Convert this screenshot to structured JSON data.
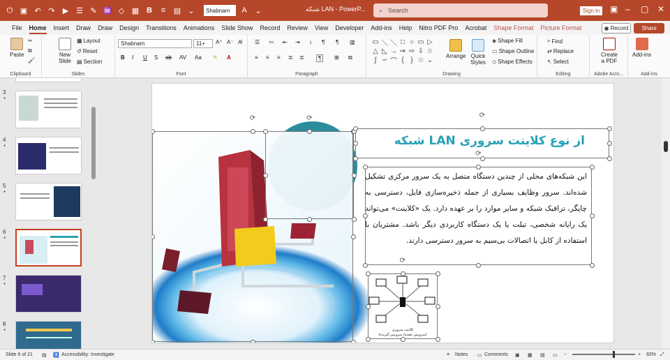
{
  "titlebar": {
    "font_name": "Shabnam",
    "doc_title": "شبکه LAN  -  PowerP...",
    "search_placeholder": "Search",
    "sign_in": "Sign in",
    "accent": "#b7472a"
  },
  "tabs": [
    "File",
    "Home",
    "Insert",
    "Draw",
    "Draw",
    "Design",
    "Transitions",
    "Animations",
    "Slide Show",
    "Record",
    "Review",
    "View",
    "Developer",
    "Add-ins",
    "Help",
    "Nitro PDF Pro",
    "Acrobat"
  ],
  "context_tabs": [
    "Shape Format",
    "Picture Format"
  ],
  "record_label": "Record",
  "share_label": "Share",
  "ribbon": {
    "clipboard": {
      "paste": "Paste",
      "label": "Clipboard"
    },
    "slides": {
      "new_slide": "New Slide",
      "layout": "Layout",
      "reset": "Reset",
      "section": "Section",
      "label": "Slides"
    },
    "font": {
      "name": "Shabnam",
      "size": "11+",
      "label": "Font",
      "bold": "B",
      "italic": "I",
      "underline": "U",
      "strike": "S",
      "shadow": "ab",
      "spacing": "AV",
      "case": "Aa"
    },
    "paragraph": {
      "label": "Paragraph"
    },
    "drawing": {
      "arrange": "Arrange",
      "quick_styles": "Quick Styles",
      "fill": "Shape Fill",
      "outline": "Shape Outline",
      "effects": "Shape Effects",
      "label": "Drawing"
    },
    "editing": {
      "find": "Find",
      "replace": "Replace",
      "select": "Select",
      "label": "Editing"
    },
    "acrobat": {
      "create": "Create a PDF",
      "label": "Adobe Acro..."
    },
    "addins": {
      "button": "Add-ins",
      "label": "Add-ins"
    }
  },
  "thumbnails": [
    {
      "num": "3",
      "star": "*"
    },
    {
      "num": "4",
      "star": "*"
    },
    {
      "num": "5",
      "star": "*"
    },
    {
      "num": "6",
      "star": "*"
    },
    {
      "num": "7",
      "star": "*"
    },
    {
      "num": "8",
      "star": "*"
    }
  ],
  "slide": {
    "title": "شبکه LAN از نوع کلاینت سروری",
    "body": "این شبکه‌های محلی از چندین دستگاه متصل به یک سرور مرکزی تشکیل شده‌اند. سرور وظایف بسیاری از جمله ذخیره‌سازی فایل، دسترسی به چاپگر، ترافیک شبکه و سایر موارد را بر عهده دارد. یک «کلاینت» می‌تواند یک رایانه شخصی، تبلت یا یک دستگاه کاربردی دیگر باشد. مشتریان با استفاده از کابل یا اتصالات بی‌سیم به سرور دسترسی دارند.",
    "diagram_caption_1": "کلاینت سروری",
    "diagram_caption_2": "(سرویس دهنده/ سرویس گیرنده)",
    "title_color": "#27a2b5"
  },
  "status": {
    "slide_info": "Slide 6 of 21",
    "accessibility": "Accessibility: Investigate",
    "notes": "Notes",
    "comments": "Comments",
    "zoom": "83%"
  }
}
